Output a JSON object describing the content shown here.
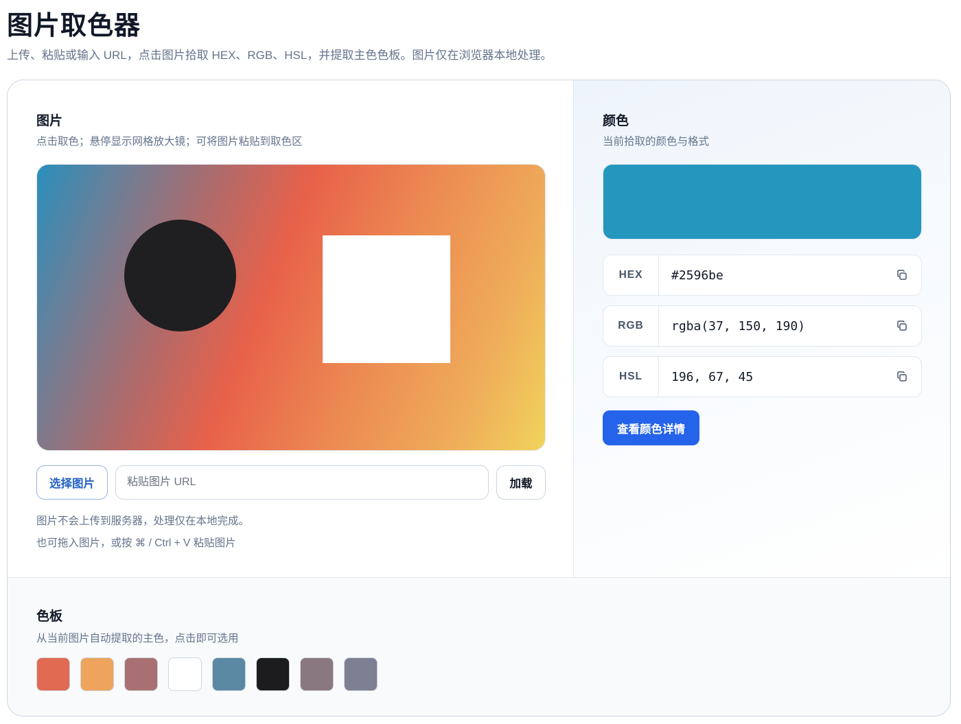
{
  "page": {
    "title": "图片取色器",
    "subtitle": "上传、粘贴或输入 URL，点击图片拾取 HEX、RGB、HSL，并提取主色色板。图片仅在浏览器本地处理。"
  },
  "image_section": {
    "title": "图片",
    "desc": "点击取色；悬停显示网格放大镜；可将图片粘贴到取色区",
    "select_button": "选择图片",
    "url_placeholder": "粘贴图片 URL",
    "load_button": "加载",
    "hint_privacy": "图片不会上传到服务器，处理仅在本地完成。",
    "hint_drag": "也可拖入图片，或按 ⌘ / Ctrl + V 粘贴图片"
  },
  "color_section": {
    "title": "颜色",
    "desc": "当前拾取的颜色与格式",
    "current_color": "#2596be",
    "formats": [
      {
        "label": "HEX",
        "value": "#2596be"
      },
      {
        "label": "RGB",
        "value": "rgba(37, 150, 190)"
      },
      {
        "label": "HSL",
        "value": "196, 67, 45"
      }
    ],
    "detail_button": "查看颜色详情",
    "copy_icon": "copy-icon"
  },
  "palette_section": {
    "title": "色板",
    "desc": "从当前图片自动提取的主色，点击即可选用",
    "colors": [
      "#e06a52",
      "#eea45c",
      "#a87072",
      "#ffffff",
      "#5b88a3",
      "#1c1c1f",
      "#8a7880",
      "#7c8092"
    ]
  }
}
